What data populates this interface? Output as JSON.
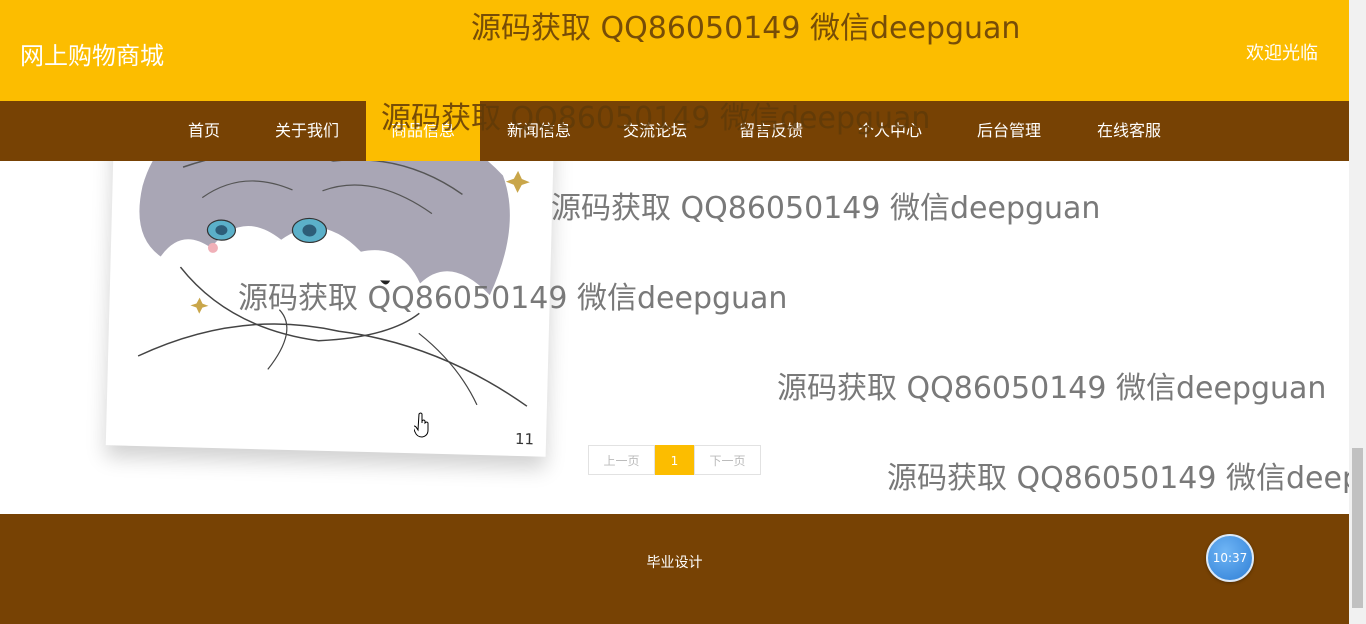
{
  "header": {
    "site_title": "网上购物商城",
    "welcome": "欢迎光临"
  },
  "nav": {
    "items": [
      {
        "label": "首页",
        "active": false
      },
      {
        "label": "关于我们",
        "active": false
      },
      {
        "label": "商品信息",
        "active": true
      },
      {
        "label": "新闻信息",
        "active": false
      },
      {
        "label": "交流论坛",
        "active": false
      },
      {
        "label": "留言反馈",
        "active": false
      },
      {
        "label": "个人中心",
        "active": false
      },
      {
        "label": "后台管理",
        "active": false
      },
      {
        "label": "在线客服",
        "active": false
      }
    ]
  },
  "product": {
    "number": "11"
  },
  "pagination": {
    "prev": "上一页",
    "current": "1",
    "next": "下一页"
  },
  "footer": {
    "text": "毕业设计"
  },
  "clock": {
    "time": "10:37"
  },
  "watermark": "源码获取 QQ86050149 微信deepguan",
  "colors": {
    "primary": "#FCBD00",
    "nav_bg": "#774204",
    "footer_bg": "#774204"
  }
}
